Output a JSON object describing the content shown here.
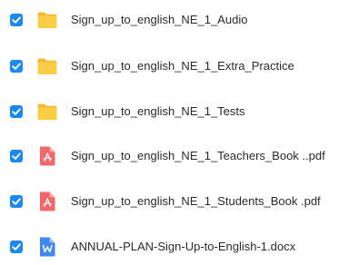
{
  "files": [
    {
      "name": "Sign_up_to_english_NE_1_Audio",
      "type": "folder",
      "icon": "folder-icon",
      "checked": true
    },
    {
      "name": "Sign_up_to_english_NE_1_Extra_Practice",
      "type": "folder",
      "icon": "folder-icon",
      "checked": true
    },
    {
      "name": "Sign_up_to_english_NE_1_Tests",
      "type": "folder",
      "icon": "folder-icon",
      "checked": true
    },
    {
      "name": "Sign_up_to_english_NE_1_Teachers_Book ..pdf",
      "type": "pdf",
      "icon": "pdf-file-icon",
      "checked": true
    },
    {
      "name": "Sign_up_to_english_NE_1_Students_Book .pdf",
      "type": "pdf",
      "icon": "pdf-file-icon",
      "checked": true
    },
    {
      "name": "ANNUAL-PLAN-Sign-Up-to-English-1.docx",
      "type": "word",
      "icon": "word-file-icon",
      "checked": true
    }
  ],
  "colors": {
    "checkbox": "#1a88f5",
    "folder": "#f7c73a",
    "pdf": "#f0686a",
    "word": "#3f86f3"
  }
}
